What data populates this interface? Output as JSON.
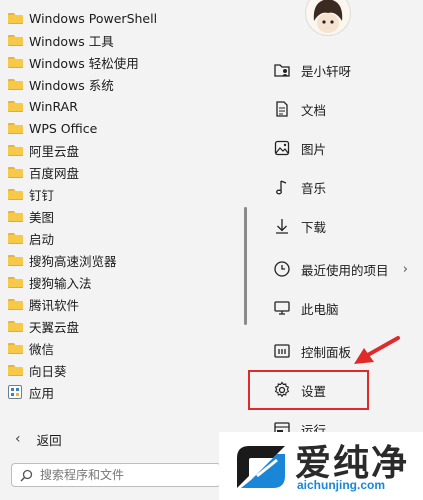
{
  "apps": [
    {
      "label": "Windows PowerShell",
      "icon": "folder-icon"
    },
    {
      "label": "Windows 工具",
      "icon": "folder-icon"
    },
    {
      "label": "Windows 轻松使用",
      "icon": "folder-icon"
    },
    {
      "label": "Windows 系统",
      "icon": "folder-icon"
    },
    {
      "label": "WinRAR",
      "icon": "folder-icon"
    },
    {
      "label": "WPS Office",
      "icon": "folder-icon"
    },
    {
      "label": "阿里云盘",
      "icon": "folder-icon"
    },
    {
      "label": "百度网盘",
      "icon": "folder-icon"
    },
    {
      "label": "钉钉",
      "icon": "folder-icon"
    },
    {
      "label": "美图",
      "icon": "folder-icon"
    },
    {
      "label": "启动",
      "icon": "folder-icon"
    },
    {
      "label": "搜狗高速浏览器",
      "icon": "folder-icon"
    },
    {
      "label": "搜狗输入法",
      "icon": "folder-icon"
    },
    {
      "label": "腾讯软件",
      "icon": "folder-icon"
    },
    {
      "label": "天翼云盘",
      "icon": "folder-icon"
    },
    {
      "label": "微信",
      "icon": "folder-icon"
    },
    {
      "label": "向日葵",
      "icon": "folder-icon"
    },
    {
      "label": "应用",
      "icon": "app-grid-icon"
    }
  ],
  "places": [
    {
      "label": "是小轩呀",
      "icon": "user-folder-icon"
    },
    {
      "label": "文档",
      "icon": "document-icon"
    },
    {
      "label": "图片",
      "icon": "picture-icon"
    },
    {
      "label": "音乐",
      "icon": "music-icon"
    },
    {
      "label": "下载",
      "icon": "download-icon"
    },
    {
      "label": "最近使用的项目",
      "icon": "clock-icon"
    },
    {
      "label": "此电脑",
      "icon": "monitor-icon"
    },
    {
      "label": "控制面板",
      "icon": "control-panel-icon"
    },
    {
      "label": "设置",
      "icon": "gear-icon"
    },
    {
      "label": "运行...",
      "icon": "run-icon"
    }
  ],
  "back": {
    "label": "返回"
  },
  "search": {
    "placeholder": "搜索程序和文件"
  },
  "watermark": {
    "cn": "爱纯净",
    "en": "aichunjing.com"
  },
  "colors": {
    "highlight": "#e02a2a",
    "folder": "#f7c948",
    "watermark_blue": "#1a86d8"
  }
}
